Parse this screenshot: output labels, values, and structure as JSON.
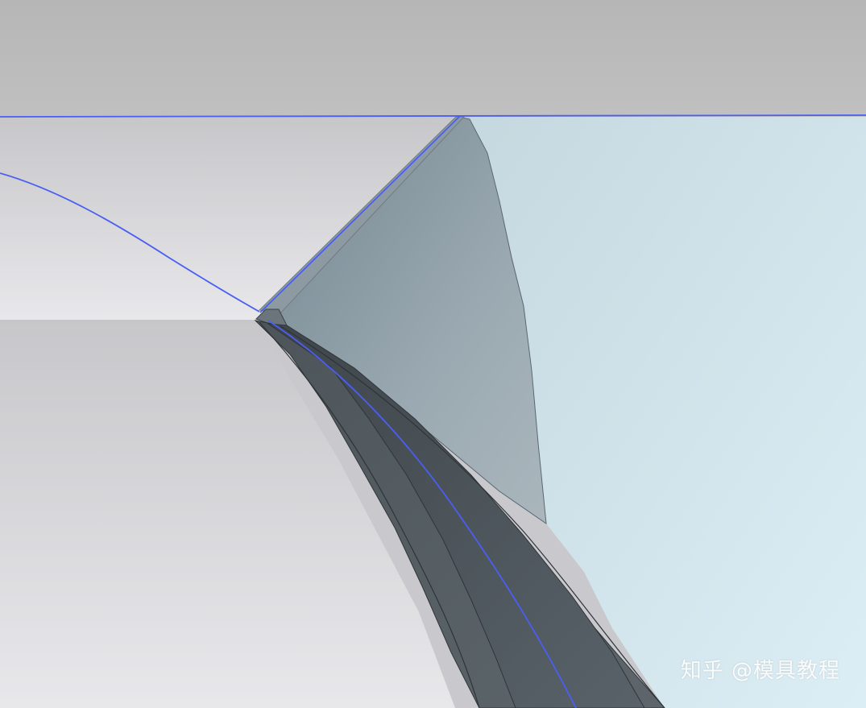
{
  "watermark": {
    "text": "知乎 @模具教程"
  },
  "colors": {
    "background_top": "#b9b9b9",
    "background_left": "#d7d7db",
    "background_right": "#d7eaf2",
    "guide_line": "#4a5ef4",
    "ridge_dark": "#3f454a",
    "ridge_mid": "#4f575d",
    "ridge_light": "#666f75",
    "face_gray": "#8e9aa1"
  }
}
